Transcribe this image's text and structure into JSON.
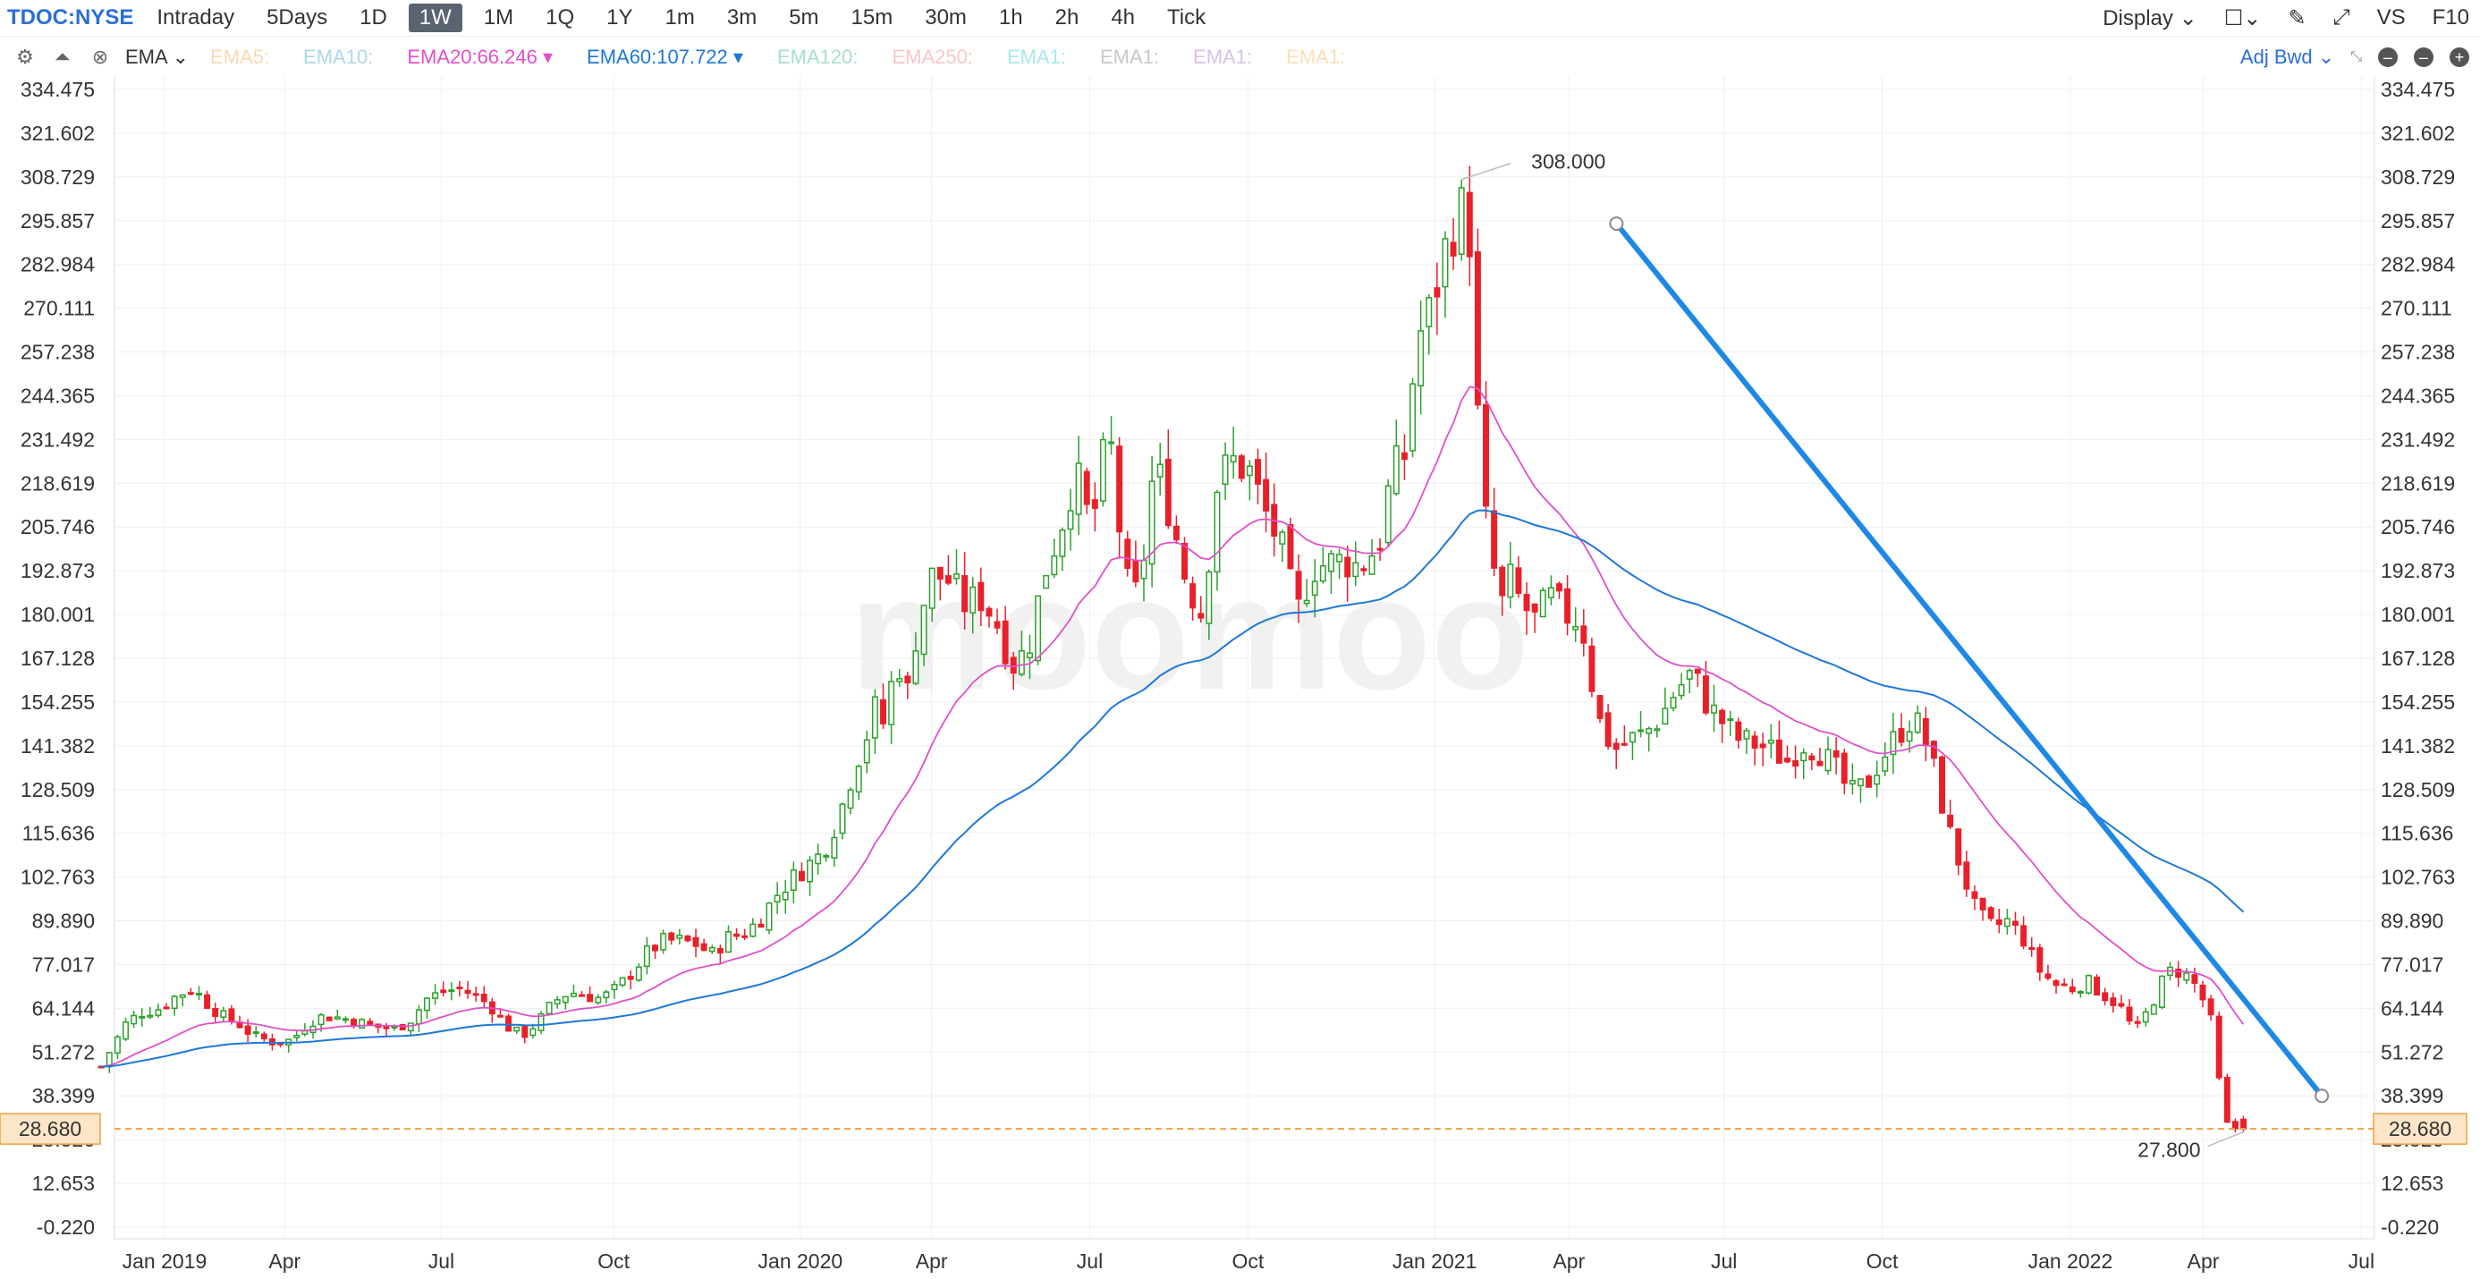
{
  "toolbar": {
    "ticker": "TDOC:NYSE",
    "timeframes": [
      "Intraday",
      "5Days",
      "1D",
      "1W",
      "1M",
      "1Q",
      "1Y",
      "1m",
      "3m",
      "5m",
      "15m",
      "30m",
      "1h",
      "2h",
      "4h",
      "Tick"
    ],
    "active_timeframe": "1W",
    "display_label": "Display",
    "vs_label": "VS",
    "f10_label": "F10"
  },
  "indicators": {
    "selector_label": "EMA",
    "items": [
      {
        "label": "EMA5:",
        "color": "#f8d9b0"
      },
      {
        "label": "EMA10:",
        "color": "#a9d8ea"
      },
      {
        "label": "EMA20:66.246",
        "color": "#e050c8",
        "arrow": true
      },
      {
        "label": "EMA60:107.722",
        "color": "#1e78d8",
        "arrow": true
      },
      {
        "label": "EMA120:",
        "color": "#a8e0c8"
      },
      {
        "label": "EMA250:",
        "color": "#f8c8c8"
      },
      {
        "label": "EMA1:",
        "color": "#a8e8ec"
      },
      {
        "label": "EMA1:",
        "color": "#c8c8c8"
      },
      {
        "label": "EMA1:",
        "color": "#d8c0ec"
      },
      {
        "label": "EMA1:",
        "color": "#f8e0b8"
      }
    ],
    "adjust_label": "Adj Bwd"
  },
  "chart_data": {
    "type": "candlestick",
    "y_ticks": [
      "334.475",
      "321.602",
      "308.729",
      "295.857",
      "282.984",
      "270.111",
      "257.238",
      "244.365",
      "231.492",
      "218.619",
      "205.746",
      "192.873",
      "180.001",
      "167.128",
      "154.255",
      "141.382",
      "128.509",
      "115.636",
      "102.763",
      "89.890",
      "77.017",
      "64.144",
      "51.272",
      "38.399",
      "25.526",
      "12.653",
      "-0.220"
    ],
    "ylim": [
      -0.22,
      334.475
    ],
    "x_ticks": [
      "Jan 2019",
      "Apr",
      "Jul",
      "Oct",
      "Jan 2020",
      "Apr",
      "Jul",
      "Oct",
      "Jan 2021",
      "Apr",
      "Jul",
      "Oct",
      "Jan 2022",
      "Apr",
      "Jul"
    ],
    "current_price": "28.680",
    "annotations": {
      "high": "308.000",
      "low": "27.800"
    },
    "trendline": {
      "start": [
        1022,
        295
      ],
      "end": [
        1468,
        38.4
      ]
    },
    "ema20_color": "#e050c8",
    "ema60_color": "#1e78d8",
    "up_color": "#2ca02c",
    "down_color": "#e8202a",
    "anchors": [
      [
        64,
        47
      ],
      [
        70,
        52
      ],
      [
        80,
        60
      ],
      [
        90,
        63
      ],
      [
        100,
        64
      ],
      [
        112,
        68
      ],
      [
        122,
        70
      ],
      [
        130,
        66
      ],
      [
        140,
        62
      ],
      [
        150,
        60
      ],
      [
        160,
        56
      ],
      [
        175,
        54
      ],
      [
        185,
        55
      ],
      [
        195,
        60
      ],
      [
        205,
        62
      ],
      [
        220,
        61
      ],
      [
        235,
        59
      ],
      [
        250,
        58
      ],
      [
        260,
        61
      ],
      [
        270,
        67
      ],
      [
        280,
        69
      ],
      [
        290,
        70
      ],
      [
        300,
        68
      ],
      [
        310,
        65
      ],
      [
        320,
        59
      ],
      [
        330,
        56
      ],
      [
        340,
        60
      ],
      [
        350,
        66
      ],
      [
        360,
        69
      ],
      [
        370,
        68
      ],
      [
        380,
        67
      ],
      [
        390,
        70
      ],
      [
        400,
        75
      ],
      [
        410,
        81
      ],
      [
        420,
        84
      ],
      [
        430,
        84
      ],
      [
        440,
        83
      ],
      [
        450,
        80
      ],
      [
        460,
        85
      ],
      [
        470,
        86
      ],
      [
        480,
        90
      ],
      [
        490,
        97
      ],
      [
        500,
        102
      ],
      [
        510,
        106
      ],
      [
        520,
        110
      ],
      [
        530,
        120
      ],
      [
        540,
        135
      ],
      [
        550,
        147
      ],
      [
        555,
        155
      ],
      [
        560,
        145
      ],
      [
        565,
        165
      ],
      [
        570,
        165
      ],
      [
        575,
        155
      ],
      [
        580,
        178
      ],
      [
        590,
        192
      ],
      [
        600,
        190
      ],
      [
        610,
        183
      ],
      [
        620,
        185
      ],
      [
        630,
        178
      ],
      [
        640,
        165
      ],
      [
        650,
        170
      ],
      [
        660,
        192
      ],
      [
        670,
        205
      ],
      [
        680,
        222
      ],
      [
        690,
        205
      ],
      [
        700,
        232
      ],
      [
        705,
        225
      ],
      [
        710,
        190
      ],
      [
        720,
        185
      ],
      [
        730,
        225
      ],
      [
        740,
        210
      ],
      [
        750,
        190
      ],
      [
        760,
        180
      ],
      [
        770,
        220
      ],
      [
        780,
        225
      ],
      [
        790,
        222
      ],
      [
        800,
        210
      ],
      [
        810,
        200
      ],
      [
        820,
        180
      ],
      [
        830,
        194
      ],
      [
        840,
        195
      ],
      [
        850,
        196
      ],
      [
        860,
        194
      ],
      [
        870,
        200
      ],
      [
        875,
        205
      ],
      [
        880,
        225
      ],
      [
        885,
        222
      ],
      [
        890,
        230
      ],
      [
        895,
        260
      ],
      [
        900,
        265
      ],
      [
        905,
        270
      ],
      [
        910,
        280
      ],
      [
        915,
        290
      ],
      [
        920,
        295
      ],
      [
        925,
        300
      ],
      [
        930,
        290
      ],
      [
        935,
        230
      ],
      [
        940,
        205
      ],
      [
        945,
        192
      ],
      [
        950,
        183
      ],
      [
        955,
        190
      ],
      [
        960,
        185
      ],
      [
        970,
        178
      ],
      [
        980,
        185
      ],
      [
        990,
        180
      ],
      [
        1000,
        178
      ],
      [
        1010,
        150
      ],
      [
        1020,
        140
      ],
      [
        1030,
        143
      ],
      [
        1040,
        145
      ],
      [
        1050,
        150
      ],
      [
        1060,
        158
      ],
      [
        1070,
        163
      ],
      [
        1080,
        153
      ],
      [
        1090,
        148
      ],
      [
        1100,
        143
      ],
      [
        1110,
        142
      ],
      [
        1120,
        140
      ],
      [
        1130,
        137
      ],
      [
        1140,
        142
      ],
      [
        1150,
        140
      ],
      [
        1160,
        135
      ],
      [
        1170,
        127
      ],
      [
        1180,
        130
      ],
      [
        1190,
        138
      ],
      [
        1200,
        145
      ],
      [
        1210,
        150
      ],
      [
        1220,
        140
      ],
      [
        1230,
        120
      ],
      [
        1240,
        105
      ],
      [
        1250,
        92
      ],
      [
        1260,
        88
      ],
      [
        1270,
        90
      ],
      [
        1280,
        84
      ],
      [
        1290,
        75
      ],
      [
        1300,
        71
      ],
      [
        1310,
        70
      ],
      [
        1320,
        72
      ],
      [
        1330,
        68
      ],
      [
        1340,
        65
      ],
      [
        1350,
        57
      ],
      [
        1360,
        65
      ],
      [
        1370,
        75
      ],
      [
        1380,
        75
      ],
      [
        1390,
        70
      ],
      [
        1400,
        58
      ],
      [
        1405,
        33
      ],
      [
        1410,
        28.5
      ],
      [
        1415,
        29
      ],
      [
        1420,
        28.7
      ]
    ]
  }
}
